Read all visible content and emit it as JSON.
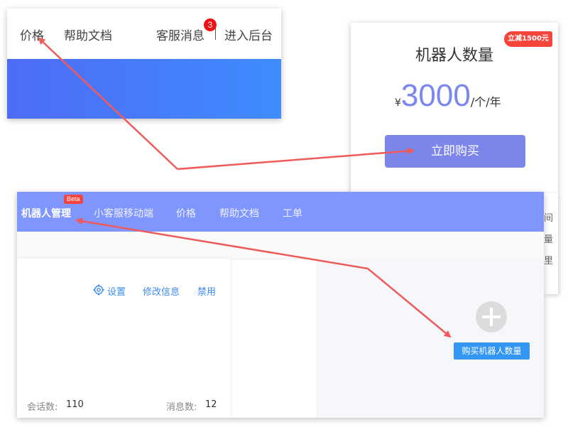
{
  "site_nav": {
    "price": "价格",
    "docs": "帮助文档",
    "messages": "客服消息",
    "message_count": "3",
    "admin": "进入后台"
  },
  "pricing_card": {
    "title": "机器人数量",
    "ribbon": "立减1500元",
    "currency": "¥",
    "price": "3000",
    "unit": "/个/年",
    "buy_label": "立即购买"
  },
  "app": {
    "nav": [
      "机器人管理",
      "小客服移动端",
      "价格",
      "帮助文档",
      "工单"
    ],
    "beta": "Beta",
    "card": {
      "settings": "设置",
      "edit": "修改信息",
      "disable": "禁用",
      "sessions_label": "会话数:",
      "sessions_value": "110",
      "messages_label": "消息数:",
      "messages_value": "12"
    },
    "buy_robots_label": "购买机器人数量"
  },
  "edge_glyphs": [
    "间",
    "量",
    "里"
  ],
  "colors": {
    "hero_start": "#4e6cf6",
    "hero_end": "#3f8bff",
    "accent_purple": "#7b85ea",
    "app_nav": "#8096ff",
    "link_blue": "#3b8cf2",
    "badge_red": "#ee1212",
    "arrow_red": "#f05a5a"
  },
  "icons": [
    "gear-icon",
    "plus-icon",
    "arrow"
  ]
}
